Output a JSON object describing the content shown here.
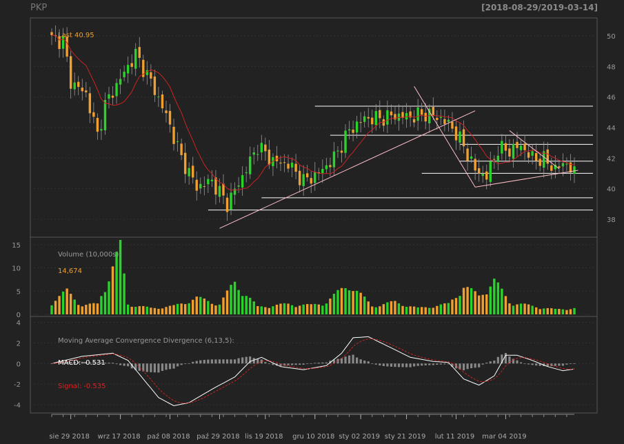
{
  "header": {
    "symbol": "PKP",
    "date_range": "[2018-08-29/2019-03-14]"
  },
  "price_panel": {
    "last_label": "Last 40.95",
    "yticks": [
      38,
      40,
      42,
      44,
      46,
      48,
      50
    ]
  },
  "volume_panel": {
    "title": "Volume (10,000s):",
    "last_value": "14,674",
    "yticks": [
      0,
      5,
      10,
      15
    ]
  },
  "macd_panel": {
    "title": "Moving Average Convergence Divergence (6,13,5):",
    "macd_label": "MACD: -0.531",
    "signal_label": "Signal: -0.535",
    "yticks": [
      -4,
      -2,
      0,
      2,
      4
    ]
  },
  "x_axis": {
    "labels": [
      "sie 29 2018",
      "wrz 17 2018",
      "paź 08 2018",
      "paź 29 2018",
      "lis 19 2018",
      "gru 10 2018",
      "sty 02 2019",
      "sty 21 2019",
      "lut 11 2019",
      "mar 04 2019"
    ]
  },
  "colors": {
    "up": "#2bd22b",
    "down": "#f0a030",
    "ma": "#cc2222",
    "macd": "#ffffff",
    "signal": "#cc2222",
    "hist": "#888888",
    "lines": "#ffffff",
    "trend": "#ffc0cb"
  },
  "chart_data": {
    "type": "candlestick",
    "series_count": 138,
    "price_anchors": [
      [
        0,
        49.8
      ],
      [
        3,
        49.7
      ],
      [
        5,
        47.0
      ],
      [
        9,
        46.2
      ],
      [
        12,
        43.5
      ],
      [
        14,
        45.5
      ],
      [
        18,
        47.2
      ],
      [
        22,
        48.8
      ],
      [
        26,
        47.0
      ],
      [
        30,
        44.8
      ],
      [
        34,
        42.0
      ],
      [
        38,
        40.1
      ],
      [
        42,
        40.5
      ],
      [
        46,
        39.0
      ],
      [
        50,
        40.8
      ],
      [
        54,
        42.8
      ],
      [
        58,
        41.8
      ],
      [
        62,
        41.6
      ],
      [
        66,
        40.5
      ],
      [
        70,
        41.0
      ],
      [
        74,
        42.0
      ],
      [
        78,
        43.8
      ],
      [
        82,
        44.6
      ],
      [
        86,
        44.6
      ],
      [
        90,
        44.8
      ],
      [
        94,
        44.7
      ],
      [
        98,
        44.9
      ],
      [
        102,
        44.6
      ],
      [
        105,
        44.0
      ],
      [
        108,
        42.8
      ],
      [
        111,
        41.2
      ],
      [
        114,
        40.8
      ],
      [
        117,
        42.6
      ],
      [
        120,
        42.5
      ],
      [
        123,
        42.8
      ],
      [
        126,
        42.0
      ],
      [
        129,
        41.9
      ],
      [
        132,
        41.3
      ],
      [
        135,
        41.7
      ],
      [
        137,
        40.95
      ]
    ],
    "volume_anchors": [
      [
        0,
        3
      ],
      [
        4,
        5.6
      ],
      [
        8,
        2.2
      ],
      [
        12,
        2.5
      ],
      [
        18,
        16.0
      ],
      [
        20,
        2.5
      ],
      [
        26,
        1.5
      ],
      [
        32,
        2.0
      ],
      [
        38,
        4.0
      ],
      [
        44,
        2.5
      ],
      [
        48,
        7.8
      ],
      [
        54,
        1.8
      ],
      [
        62,
        2.5
      ],
      [
        68,
        2.2
      ],
      [
        72,
        3.0
      ],
      [
        78,
        7.5
      ],
      [
        84,
        2.0
      ],
      [
        90,
        3.0
      ],
      [
        96,
        1.5
      ],
      [
        104,
        2.5
      ],
      [
        108,
        6.8
      ],
      [
        112,
        4.5
      ],
      [
        116,
        8.2
      ],
      [
        120,
        3.0
      ],
      [
        126,
        2.0
      ],
      [
        132,
        1.2
      ],
      [
        137,
        1.5
      ]
    ],
    "macd_anchors": [
      [
        0,
        0.0
      ],
      [
        8,
        0.7
      ],
      [
        16,
        1.0
      ],
      [
        20,
        0.3
      ],
      [
        24,
        -1.5
      ],
      [
        28,
        -3.3
      ],
      [
        32,
        -4.1
      ],
      [
        36,
        -3.8
      ],
      [
        42,
        -2.5
      ],
      [
        48,
        -1.3
      ],
      [
        52,
        0.2
      ],
      [
        55,
        0.6
      ],
      [
        60,
        -0.3
      ],
      [
        66,
        -0.6
      ],
      [
        72,
        -0.2
      ],
      [
        76,
        1.0
      ],
      [
        79,
        2.5
      ],
      [
        83,
        2.6
      ],
      [
        88,
        1.7
      ],
      [
        94,
        0.6
      ],
      [
        100,
        0.2
      ],
      [
        104,
        0.1
      ],
      [
        108,
        -1.5
      ],
      [
        112,
        -2.1
      ],
      [
        116,
        -1.2
      ],
      [
        119,
        0.8
      ],
      [
        122,
        0.8
      ],
      [
        126,
        0.3
      ],
      [
        130,
        -0.3
      ],
      [
        134,
        -0.7
      ],
      [
        137,
        -0.53
      ]
    ],
    "horizontal_levels": [
      {
        "y": 45.4,
        "x0": 69,
        "x1": 137
      },
      {
        "y": 43.5,
        "x0": 73,
        "x1": 137
      },
      {
        "y": 42.9,
        "x0": 107,
        "x1": 137
      },
      {
        "y": 41.8,
        "x0": 107,
        "x1": 137
      },
      {
        "y": 41.0,
        "x0": 97,
        "x1": 137
      },
      {
        "y": 39.4,
        "x0": 55,
        "x1": 137
      },
      {
        "y": 38.6,
        "x0": 41,
        "x1": 137
      }
    ],
    "trend_lines": [
      {
        "p0": [
          44,
          37.4
        ],
        "p1": [
          111,
          45.1
        ]
      },
      {
        "p0": [
          95,
          46.7
        ],
        "p1": [
          111,
          40.1
        ]
      },
      {
        "p0": [
          111,
          40.1
        ],
        "p1": [
          138,
          41.2
        ]
      },
      {
        "p0": [
          120,
          43.8
        ],
        "p1": [
          133,
          41.3
        ]
      }
    ],
    "price_ylim": [
      37,
      51
    ],
    "volume_ylim": [
      0,
      16
    ],
    "macd_ylim": [
      -4.6,
      4.3
    ],
    "x_label_index": [
      5,
      18,
      31,
      44,
      56,
      69,
      81,
      93,
      106,
      119
    ]
  }
}
